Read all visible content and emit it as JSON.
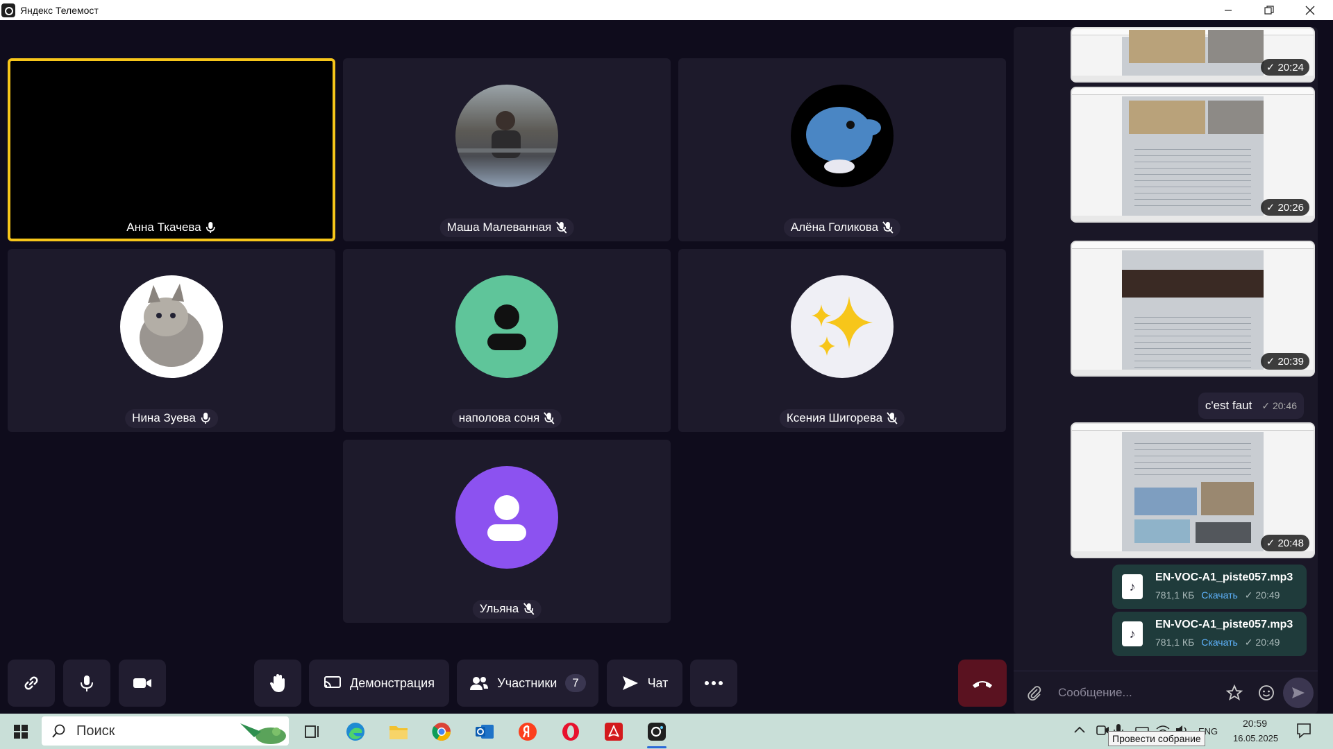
{
  "window": {
    "title": "Яндекс Телемост"
  },
  "participants": [
    {
      "name": "Анна Ткачева",
      "mic": "on",
      "speaking": true
    },
    {
      "name": "Маша Малеванная",
      "mic": "off"
    },
    {
      "name": "Алёна Голикова",
      "mic": "off"
    },
    {
      "name": "Нина Зуева",
      "mic": "on"
    },
    {
      "name": "наполова соня",
      "mic": "off"
    },
    {
      "name": "Ксения Шигорева",
      "mic": "off"
    },
    {
      "name": "Ульяна",
      "mic": "off"
    }
  ],
  "toolbar": {
    "demo_label": "Демонстрация",
    "participants_label": "Участники",
    "participants_count": "7",
    "chat_label": "Чат"
  },
  "chat": {
    "image_times": [
      "✓ 20:24",
      "✓ 20:26",
      "✓ 20:39",
      "✓ 20:48"
    ],
    "text_message": {
      "text": "c'est faut",
      "time": "✓ 20:46"
    },
    "files": [
      {
        "name": "EN-VOC-A1_piste057.mp3",
        "size": "781,1 КБ",
        "download": "Скачать",
        "time": "✓ 20:49"
      },
      {
        "name": "EN-VOC-A1_piste057.mp3",
        "size": "781,1 КБ",
        "download": "Скачать",
        "time": "✓ 20:49"
      }
    ],
    "composer_placeholder": "Сообщение..."
  },
  "taskbar": {
    "search_placeholder": "Поиск",
    "language": "ENG",
    "time": "20:59",
    "date": "16.05.2025",
    "tooltip": "Провести собрание"
  },
  "colors": {
    "active_border": "#f7c61a",
    "end_call": "#5a1220",
    "tile_bg": "#1d1a2b"
  }
}
